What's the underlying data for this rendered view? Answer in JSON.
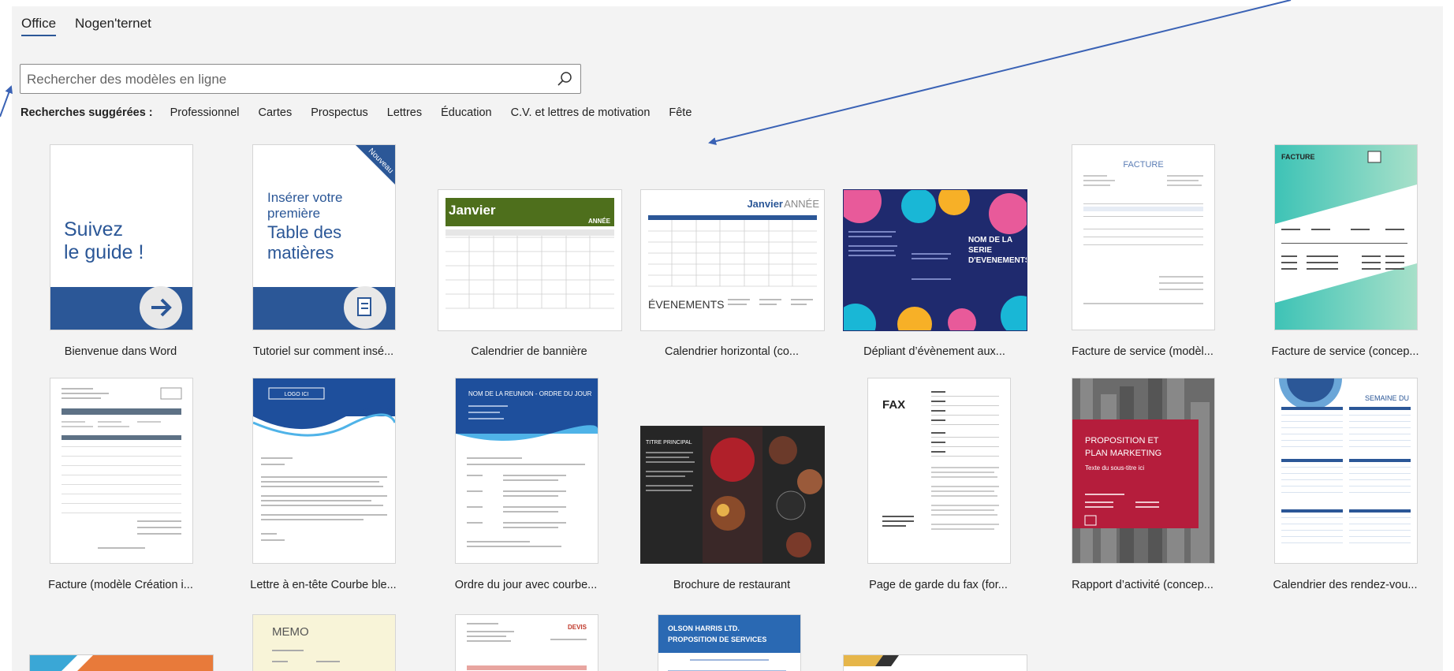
{
  "tabs": [
    {
      "label": "Office",
      "active": true
    },
    {
      "label": "Nogen'ternet",
      "active": false
    }
  ],
  "search": {
    "placeholder": "Rechercher des modèles en ligne",
    "value": ""
  },
  "suggested": {
    "label": "Recherches suggérées :",
    "items": [
      "Professionnel",
      "Cartes",
      "Prospectus",
      "Lettres",
      "Éducation",
      "C.V. et lettres de motivation",
      "Fête"
    ]
  },
  "templates": [
    {
      "caption": "Bienvenue dans Word",
      "thumb_lines": [
        "Suivez",
        "le guide !"
      ]
    },
    {
      "caption": "Tutoriel sur comment insé...",
      "thumb_lines": [
        "Insérer votre",
        "première",
        "Table des",
        "matières"
      ],
      "ribbon": "Nouveau"
    },
    {
      "caption": "Calendrier de bannière",
      "thumb_lines": [
        "Janvier",
        "ANNÉE"
      ]
    },
    {
      "caption": "Calendrier horizontal (co...",
      "thumb_lines": [
        "Janvier",
        "ANNÉE",
        "ÉVENEMENTS"
      ]
    },
    {
      "caption": "Dépliant d’évènement aux...",
      "thumb_lines": [
        "NOM DE LA",
        "SERIE",
        "D'EVENEMENTS"
      ]
    },
    {
      "caption": "Facture de service (modèl...",
      "thumb_lines": [
        "FACTURE"
      ]
    },
    {
      "caption": "Facture de service (concep...",
      "thumb_lines": [
        "FACTURE"
      ]
    },
    {
      "caption": "Facture (modèle Création i...",
      "thumb_lines": []
    },
    {
      "caption": "Lettre à en-tête Courbe ble...",
      "thumb_lines": [
        "LOGO ICI"
      ]
    },
    {
      "caption": "Ordre du jour avec courbe...",
      "thumb_lines": [
        "NOM DE LA REUNION - ORDRE DU JOUR"
      ]
    },
    {
      "caption": "Brochure de restaurant",
      "thumb_lines": [
        "TITRE PRINCIPAL"
      ]
    },
    {
      "caption": "Page de garde du fax (for...",
      "thumb_lines": [
        "FAX"
      ]
    },
    {
      "caption": "Rapport d’activité (concep...",
      "thumb_lines": [
        "PROPOSITION ET",
        "PLAN MARKETING",
        "Texte du sous-titre ici"
      ]
    },
    {
      "caption": "Calendrier des rendez-vou...",
      "thumb_lines": [
        "SEMAINE DU"
      ]
    },
    {
      "caption": "",
      "thumb_lines": []
    },
    {
      "caption": "",
      "thumb_lines": [
        "MEMO"
      ]
    },
    {
      "caption": "",
      "thumb_lines": [
        "DEVIS"
      ]
    },
    {
      "caption": "",
      "thumb_lines": [
        "OLSON HARRIS LTD.",
        "PROPOSITION DE SERVICES"
      ]
    },
    {
      "caption": "",
      "thumb_lines": []
    }
  ],
  "colors": {
    "accent": "#2b5797",
    "arrow": "#3a62b5",
    "panel": "#f3f3f3"
  }
}
